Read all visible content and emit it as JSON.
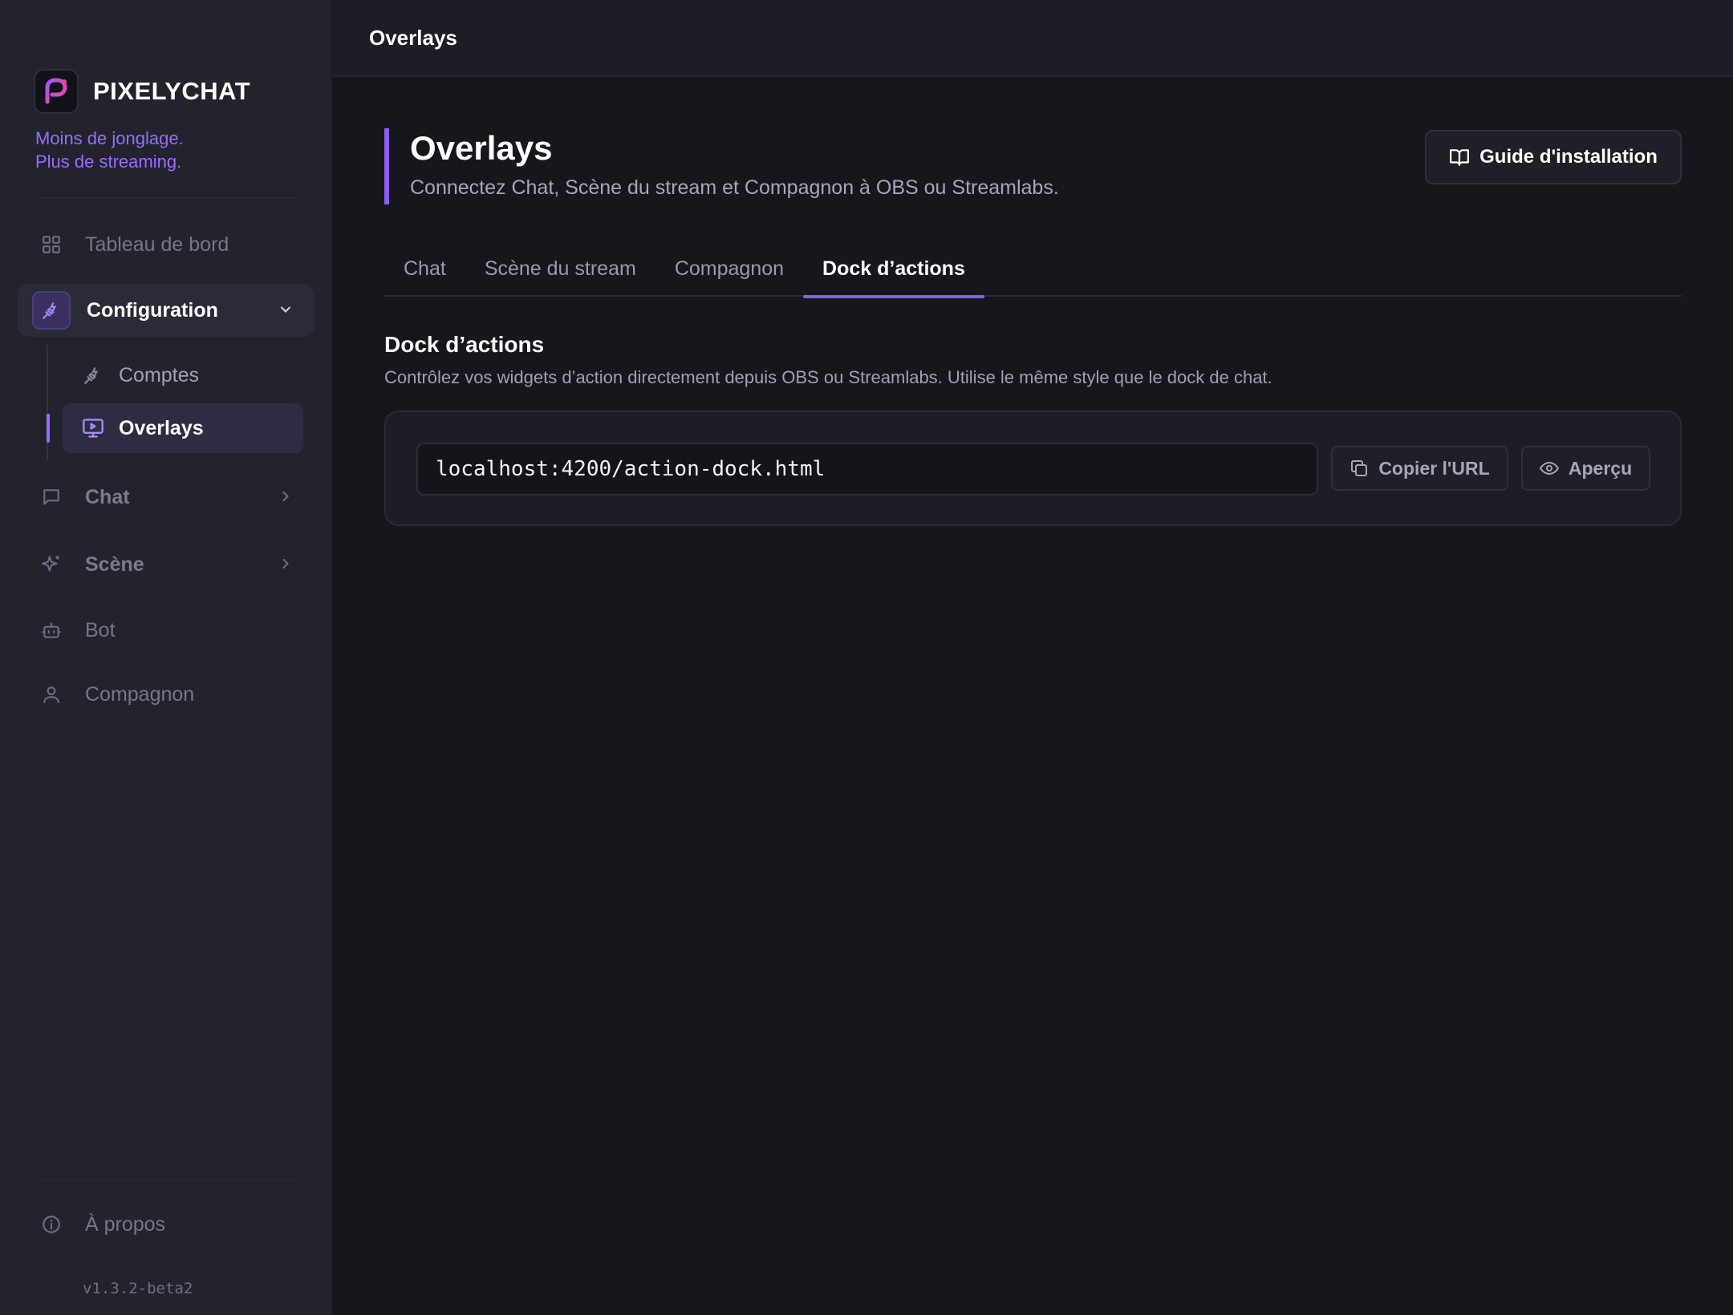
{
  "app": {
    "brand_name": "PIXELYCHAT",
    "tagline_line1": "Moins de jonglage.",
    "tagline_line2": "Plus de streaming.",
    "version": "v1.3.2-beta2",
    "accent_color": "#8b5cf6"
  },
  "sidebar": {
    "items": [
      {
        "label": "Tableau de bord",
        "icon": "grid-icon"
      },
      {
        "label": "Configuration",
        "icon": "plug-icon",
        "expanded": true
      },
      {
        "label": "Chat",
        "icon": "chat-bubble-icon"
      },
      {
        "label": "Scène",
        "icon": "sparkle-icon"
      },
      {
        "label": "Bot",
        "icon": "bot-icon"
      },
      {
        "label": "Compagnon",
        "icon": "user-icon"
      }
    ],
    "config_sub": [
      {
        "label": "Comptes",
        "icon": "plug-icon"
      },
      {
        "label": "Overlays",
        "icon": "monitor-play-icon",
        "active": true
      }
    ],
    "about": {
      "label": "À propos",
      "icon": "info-icon"
    }
  },
  "topbar": {
    "title": "Overlays"
  },
  "page": {
    "title": "Overlays",
    "subtitle": "Connectez Chat, Scène du stream et Compagnon à OBS ou Streamlabs.",
    "guide_button": "Guide d'installation"
  },
  "tabs": [
    {
      "label": "Chat",
      "active": false
    },
    {
      "label": "Scène du stream",
      "active": false
    },
    {
      "label": "Compagnon",
      "active": false
    },
    {
      "label": "Dock d’actions",
      "active": true
    }
  ],
  "section": {
    "title": "Dock d’actions",
    "description": "Contrôlez vos widgets d’action directement depuis OBS ou Streamlabs. Utilise le même style que le dock de chat.",
    "url": "localhost:4200/action-dock.html",
    "copy_button": "Copier l'URL",
    "preview_button": "Aperçu"
  }
}
